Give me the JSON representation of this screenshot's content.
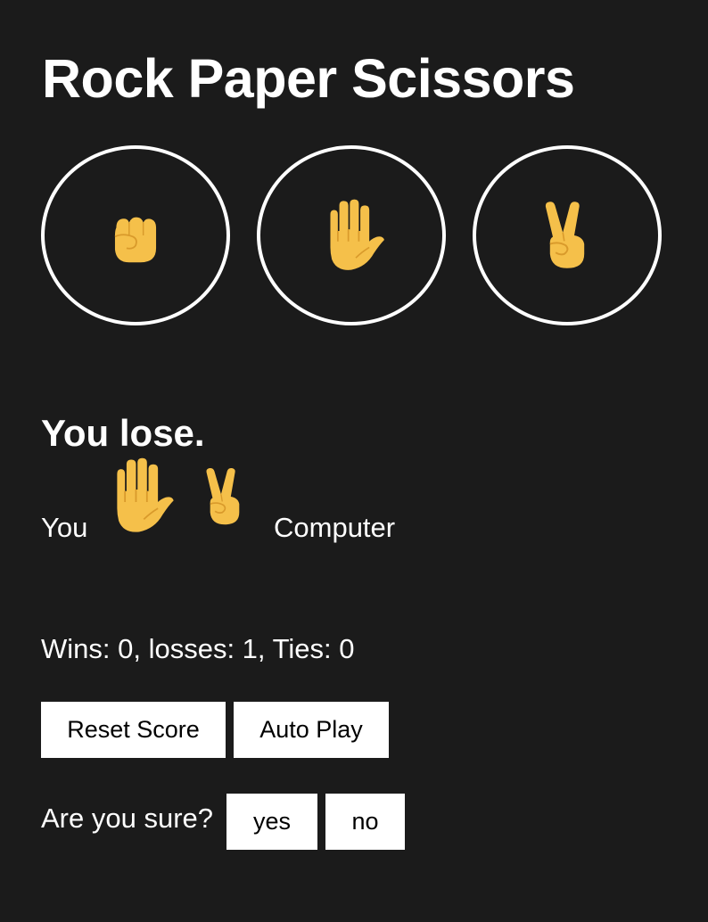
{
  "title": "Rock Paper Scissors",
  "moves": [
    {
      "name": "rock",
      "icon": "raised-fist-icon"
    },
    {
      "name": "paper",
      "icon": "raised-hand-icon"
    },
    {
      "name": "scissors",
      "icon": "victory-hand-icon"
    }
  ],
  "result": {
    "text": "You lose.",
    "you_label": "You",
    "computer_label": "Computer",
    "player_move_icon": "raised-hand-icon",
    "computer_move_icon": "victory-hand-icon"
  },
  "score": {
    "text": "Wins: 0, losses: 1, Ties: 0",
    "wins": 0,
    "losses": 1,
    "ties": 0
  },
  "buttons": {
    "reset_label": "Reset Score",
    "auto_play_label": "Auto Play"
  },
  "confirm": {
    "question": "Are you sure?",
    "yes_label": "yes",
    "no_label": "no"
  },
  "colors": {
    "background": "#1b1b1b",
    "text": "#ffffff",
    "button_bg": "#ffffff",
    "button_text": "#000000",
    "hand_fill": "#f5c04a",
    "hand_line": "#d99a2b"
  }
}
